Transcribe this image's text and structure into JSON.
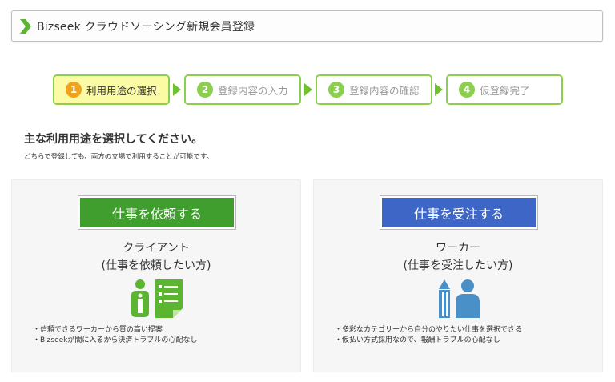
{
  "header": {
    "title": "Bizseek クラウドソーシング新規会員登録"
  },
  "steps": [
    {
      "num": "1",
      "label": "利用用途の選択"
    },
    {
      "num": "2",
      "label": "登録内容の入力"
    },
    {
      "num": "3",
      "label": "登録内容の確認"
    },
    {
      "num": "4",
      "label": "仮登録完了"
    }
  ],
  "active_step": 1,
  "main": {
    "heading": "主な利用用途を選択してください。",
    "subtext": "どちらで登録しても、両方の立場で利用することが可能です。"
  },
  "client": {
    "button_label": "仕事を依頼する",
    "title": "クライアント",
    "subtitle": "(仕事を依頼したい方)",
    "icon": "client-person-document-icon",
    "features": [
      "・信頼できるワーカーから質の高い提案",
      "・Bizseekが間に入るから決済トラブルの心配なし"
    ]
  },
  "worker": {
    "button_label": "仕事を受注する",
    "title": "ワーカー",
    "subtitle": "(仕事を受注したい方)",
    "icon": "worker-pencil-person-icon",
    "features": [
      "・多彩なカテゴリーから自分のやりたい仕事を選択できる",
      "・仮払い方式採用なので、報酬トラブルの心配なし"
    ]
  },
  "colors": {
    "accent_green": "#8ccf4f",
    "arrow_green": "#6fc12d",
    "active_step_bg": "#fbfba6",
    "active_step_badge": "#f0a21c",
    "client_button": "#3f9e2d",
    "worker_button": "#3d66c7",
    "client_icon": "#5cb531",
    "worker_icon": "#4a90c8"
  }
}
